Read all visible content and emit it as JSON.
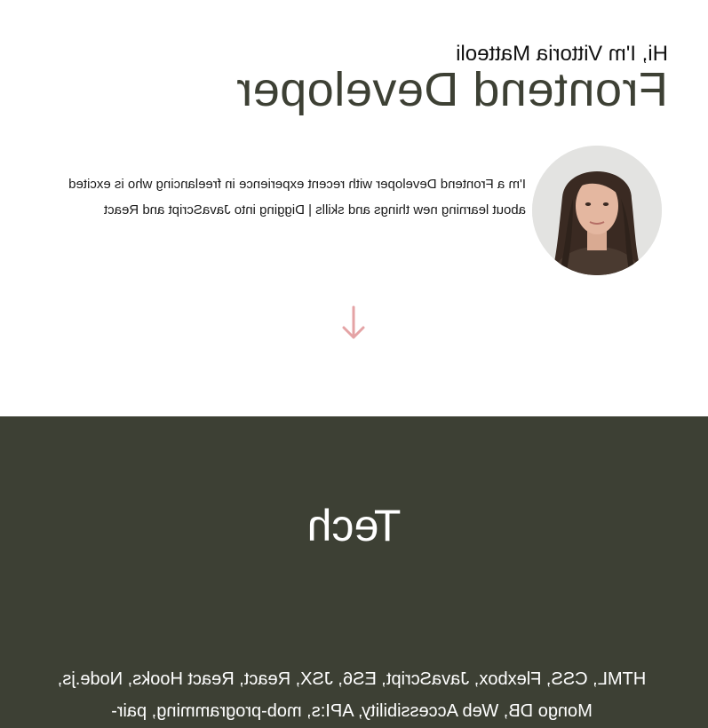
{
  "hero": {
    "greeting": "Hi, I'm Vittoria Matteoli",
    "role": "Frontend Developer",
    "intro": "I'm a Frontend Developer with recent experience in freelancing who is excited about learning new things and skills | Digging into JavaScript and React",
    "avatar_icon": "portrait-photo",
    "scroll_icon": "arrow-down-icon"
  },
  "tech": {
    "title": "Tech",
    "list": "HTML, CSS, Flexbox, JavaScript, ES6, JSX, React, React Hooks, Node.js, Mongo DB, Web Accessibility, API:s, mob-programming, pair-"
  },
  "colors": {
    "accent": "#e4a3a5",
    "dark": "#3d4034",
    "background": "#ffffff",
    "text": "#111111"
  }
}
